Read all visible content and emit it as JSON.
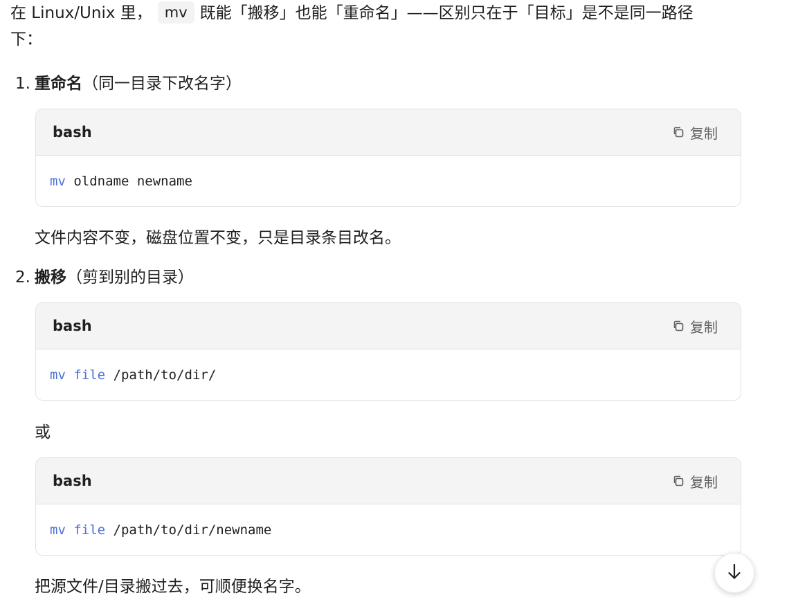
{
  "intro": {
    "before": "在 Linux/Unix 里，",
    "code": "mv",
    "after": "既能「搬移」也能「重命名」——区别只在于「目标」是不是同一路径下："
  },
  "items": [
    {
      "number": "1.",
      "title": "重命名",
      "subtitle": "（同一目录下改名字）"
    },
    {
      "number": "2.",
      "title": "搬移",
      "subtitle": "（剪到别的目录）"
    }
  ],
  "code_blocks": [
    {
      "lang": "bash",
      "copy_label": "复制",
      "tokens": [
        {
          "text": "mv",
          "kind": "kw"
        },
        {
          "text": " oldname newname",
          "kind": "plain"
        }
      ]
    },
    {
      "lang": "bash",
      "copy_label": "复制",
      "tokens": [
        {
          "text": "mv",
          "kind": "kw"
        },
        {
          "text": " ",
          "kind": "plain"
        },
        {
          "text": "file",
          "kind": "kw"
        },
        {
          "text": " /path/to/dir/",
          "kind": "plain"
        }
      ]
    },
    {
      "lang": "bash",
      "copy_label": "复制",
      "tokens": [
        {
          "text": "mv",
          "kind": "kw"
        },
        {
          "text": " ",
          "kind": "plain"
        },
        {
          "text": "file",
          "kind": "kw"
        },
        {
          "text": " /path/to/dir/newname",
          "kind": "plain"
        }
      ]
    }
  ],
  "paragraphs": {
    "rename_note": "文件内容不变，磁盘位置不变，只是目录条目改名。",
    "or": "或",
    "move_note": "把源文件/目录搬过去，可顺便换名字。"
  },
  "colors": {
    "keyword": "#4a72d8",
    "code_header_bg": "#f4f4f4",
    "border": "#e2e2e2"
  },
  "icons": {
    "copy": "copy-icon",
    "scroll": "arrow-down-icon"
  }
}
